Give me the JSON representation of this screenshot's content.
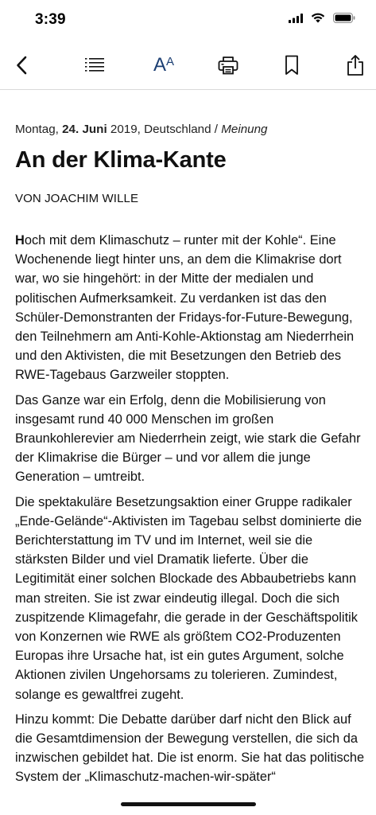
{
  "status": {
    "time": "3:39"
  },
  "toolbar": {
    "icons": [
      "back-chevron-icon",
      "list-icon",
      "text-size-icon",
      "print-icon",
      "bookmark-icon",
      "share-icon"
    ],
    "text_size_big": "A",
    "text_size_small": "A",
    "accent_color": "#1c3f73"
  },
  "article": {
    "dateline": {
      "weekday": "Montag, ",
      "day_month": "24. Juni",
      "year_place": " 2019, Deutschland / ",
      "section": "Meinung"
    },
    "title": "An der Klima-Kante",
    "byline": "VON JOACHIM WILLE",
    "paragraphs": [
      {
        "dropcap": "H",
        "text": "och mit dem Klimaschutz – runter mit der Kohle“. Eine Wochenende liegt hinter uns, an dem die Klimakrise dort war, wo sie hingehört: in der Mitte der medialen und politischen Aufmerksamkeit. Zu verdanken ist das den Schüler-Demonstranten der Fridays-for-Future-Bewegung, den Teilnehmern am Anti-Kohle-Aktionstag am Niederrhein und den Aktivisten, die mit Besetzungen den Betrieb des RWE-Tagebaus Garzweiler stoppten."
      },
      {
        "text": "Das Ganze war ein Erfolg, denn die Mobilisierung von insgesamt rund 40 000 Menschen im großen Braunkohlerevier am Niederrhein zeigt, wie stark die Gefahr der Klimakrise die Bürger – und vor allem die junge Generation – umtreibt."
      },
      {
        "text": "Die spektakuläre Besetzungsaktion einer Gruppe radikaler „Ende-Gelände“-Aktivisten im Tagebau selbst dominierte die Berichterstattung im TV und im Internet, weil sie die stärksten Bilder und viel Dramatik lieferte. Über die Legitimität einer solchen Blockade des Abbaubetriebs kann man streiten. Sie ist zwar eindeutig illegal. Doch die sich zuspitzende Klimagefahr, die gerade in der Geschäftspolitik von Konzernen wie RWE als größtem CO2-Produzenten Europas ihre Ursache hat, ist ein gutes Argument, solche Aktionen zivilen Ungehorsams zu tolerieren. Zumindest, solange es gewaltfrei zugeht."
      },
      {
        "text": "Hinzu kommt: Die Debatte darüber darf nicht den Blick auf die Gesamtdimension der Bewegung verstellen, die sich da inzwischen gebildet hat. Die ist enorm. Sie hat das politische System der „Klimaschutz-machen-wir-später“"
      }
    ]
  }
}
